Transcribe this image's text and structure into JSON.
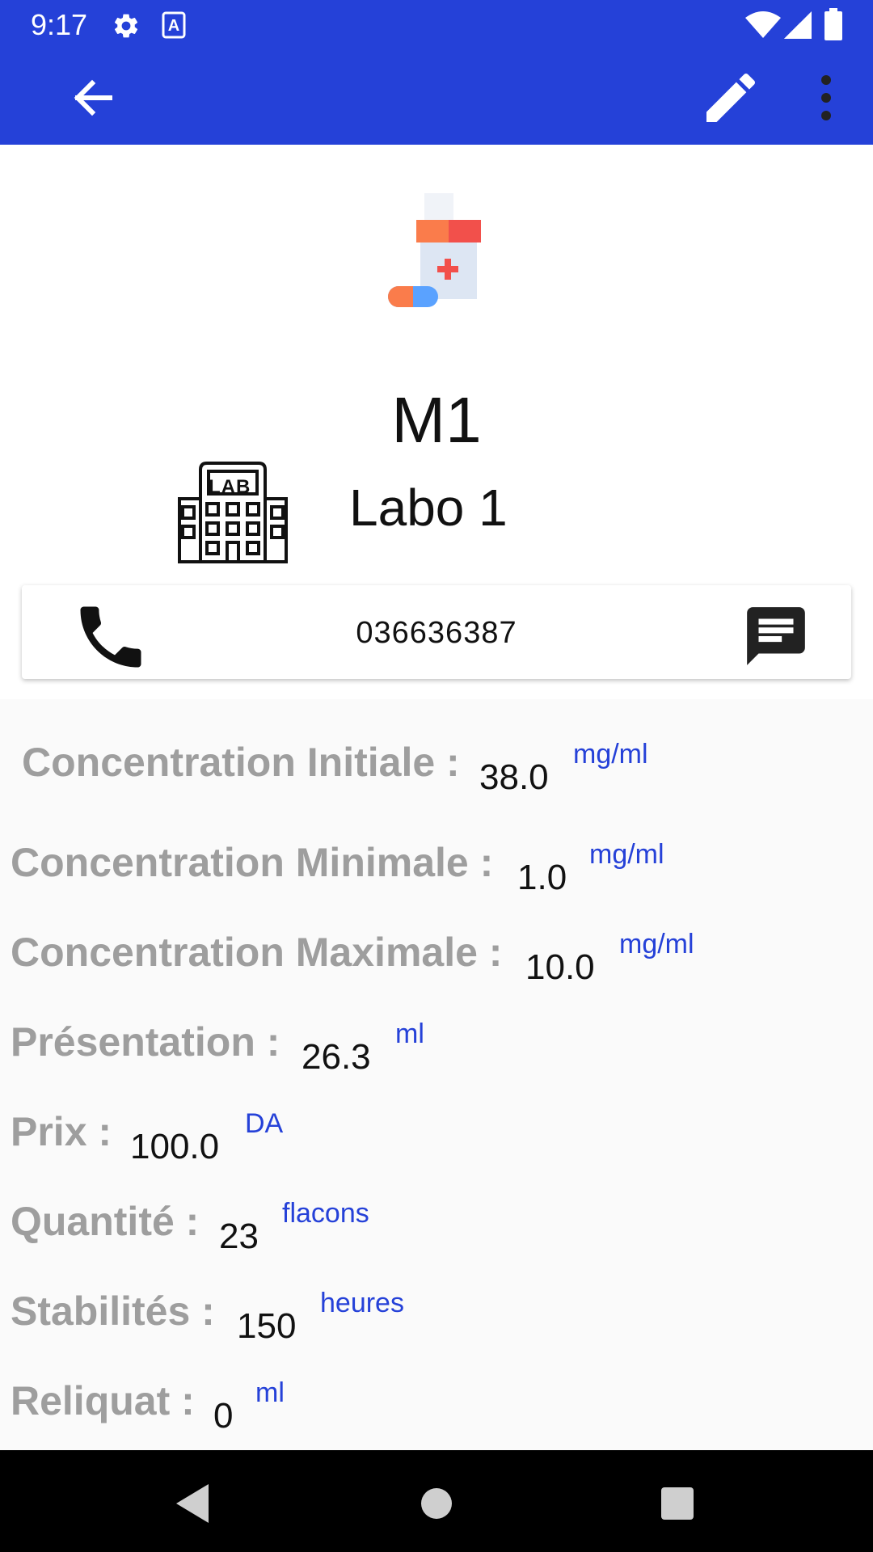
{
  "status_bar": {
    "time": "9:17",
    "icons": [
      "gear-icon",
      "accessibility-a-icon",
      "wifi-icon",
      "signal-icon",
      "battery-icon"
    ]
  },
  "app_bar": {
    "background": "#2541d8",
    "icons": [
      "arrow-back-icon",
      "pencil-edit-icon",
      "more-vertical-icon"
    ]
  },
  "medicine": {
    "name": "M1",
    "lab_icon_text": "LAB",
    "lab": "Labo 1",
    "phone": "036636387"
  },
  "details": [
    {
      "label": "Concentration Initiale :",
      "value": "38.0",
      "unit": "mg/ml"
    },
    {
      "label": "Concentration Minimale :",
      "value": "1.0",
      "unit": "mg/ml"
    },
    {
      "label": "Concentration Maximale :",
      "value": "10.0",
      "unit": "mg/ml"
    },
    {
      "label": "Présentation :",
      "value": "26.3",
      "unit": "ml"
    },
    {
      "label": "Prix :",
      "value": "100.0",
      "unit": "DA"
    },
    {
      "label": "Quantité :",
      "value": "23",
      "unit": "flacons"
    },
    {
      "label": "Stabilités :",
      "value": "150",
      "unit": "heures"
    },
    {
      "label": "Reliquat :",
      "value": "0",
      "unit": "ml"
    }
  ],
  "colors": {
    "accent": "#2541d8",
    "label_gray": "#9e9e9e",
    "unit_blue": "#2541d8"
  }
}
